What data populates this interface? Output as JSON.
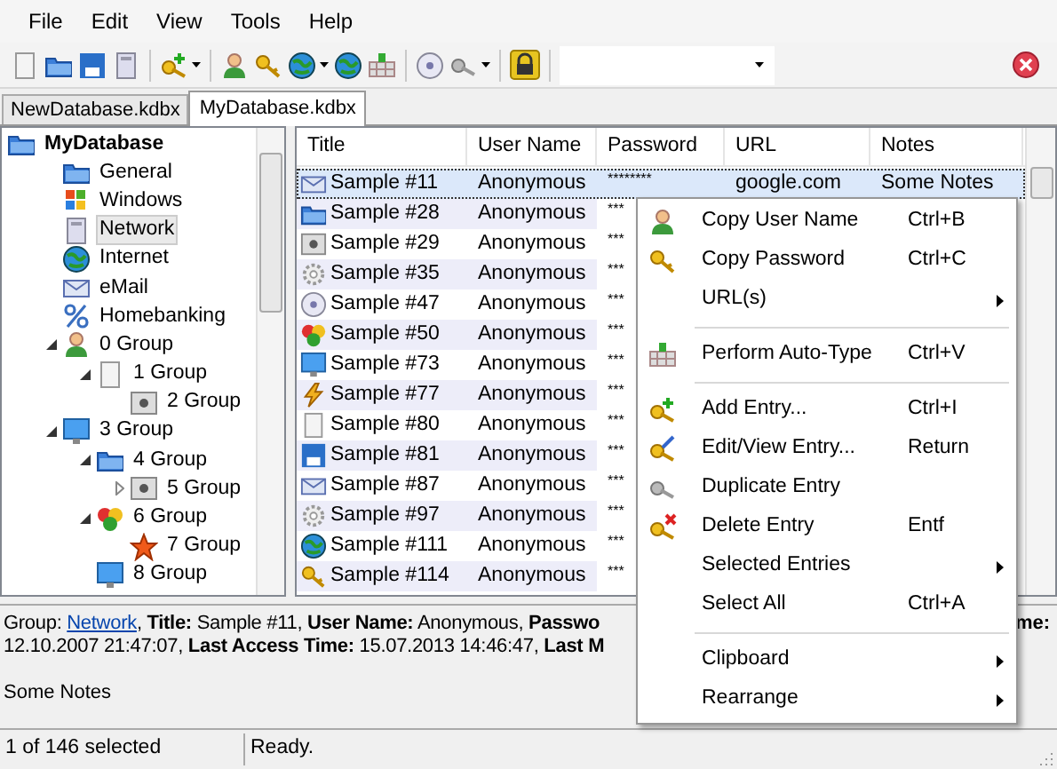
{
  "menu_bar": [
    "File",
    "Edit",
    "View",
    "Tools",
    "Help"
  ],
  "tabs": [
    {
      "label": "NewDatabase.kdbx",
      "selected": false
    },
    {
      "label": "MyDatabase.kdbx",
      "selected": true
    }
  ],
  "tree": [
    {
      "label": "MyDatabase",
      "selected": false,
      "children": [
        {
          "label": "General",
          "selected": false
        },
        {
          "label": "Windows",
          "selected": false
        },
        {
          "label": "Network",
          "selected": true
        },
        {
          "label": "Internet",
          "selected": false
        },
        {
          "label": "eMail",
          "selected": false
        },
        {
          "label": "Homebanking",
          "selected": false
        },
        {
          "label": "0 Group",
          "selected": false,
          "expanded": true,
          "children": [
            {
              "label": "1 Group",
              "selected": false,
              "expanded": true,
              "children": [
                {
                  "label": "2 Group",
                  "selected": false
                }
              ]
            }
          ]
        },
        {
          "label": "3 Group",
          "selected": false,
          "expanded": true,
          "children": [
            {
              "label": "4 Group",
              "selected": false,
              "expanded": true,
              "children": [
                {
                  "label": "5 Group",
                  "selected": false,
                  "expanded": false
                }
              ]
            },
            {
              "label": "6 Group",
              "selected": false,
              "expanded": true,
              "children": [
                {
                  "label": "7 Group",
                  "selected": false
                }
              ]
            },
            {
              "label": "8 Group",
              "selected": false
            }
          ]
        }
      ]
    }
  ],
  "table": {
    "columns": [
      "Title",
      "User Name",
      "Password",
      "URL",
      "Notes"
    ],
    "rows": [
      {
        "title": "Sample #11",
        "user_name": "Anonymous",
        "password": "********",
        "url": "google.com",
        "notes": "Some Notes",
        "selected": true
      },
      {
        "title": "Sample #28",
        "user_name": "Anonymous",
        "password": "***",
        "selected": false
      },
      {
        "title": "Sample #29",
        "user_name": "Anonymous",
        "password": "***",
        "selected": false
      },
      {
        "title": "Sample #35",
        "user_name": "Anonymous",
        "password": "***",
        "selected": false
      },
      {
        "title": "Sample #47",
        "user_name": "Anonymous",
        "password": "***",
        "selected": false
      },
      {
        "title": "Sample #50",
        "user_name": "Anonymous",
        "password": "***",
        "selected": false
      },
      {
        "title": "Sample #73",
        "user_name": "Anonymous",
        "password": "***",
        "selected": false
      },
      {
        "title": "Sample #77",
        "user_name": "Anonymous",
        "password": "***",
        "selected": false
      },
      {
        "title": "Sample #80",
        "user_name": "Anonymous",
        "password": "***",
        "selected": false
      },
      {
        "title": "Sample #81",
        "user_name": "Anonymous",
        "password": "***",
        "selected": false
      },
      {
        "title": "Sample #87",
        "user_name": "Anonymous",
        "password": "***",
        "selected": false
      },
      {
        "title": "Sample #97",
        "user_name": "Anonymous",
        "password": "***",
        "selected": false
      },
      {
        "title": "Sample #111",
        "user_name": "Anonymous",
        "password": "***",
        "selected": false
      },
      {
        "title": "Sample #114",
        "user_name": "Anonymous",
        "password": "***",
        "selected": false
      }
    ]
  },
  "details": {
    "group_label": "Group:",
    "group_link": "Network",
    "line_1_rest": ", **Title:** Sample #11, **User Name:** Anonymous, **Passwo**",
    "line_1_end": "**me:**",
    "line_2": "12.10.2007 21:47:07, **Last Access Time:** 15.07.2013 14:46:47, **Last M**",
    "notes": "Some Notes"
  },
  "context_menu": {
    "groups": [
      [
        {
          "label": "Copy User Name",
          "shortcut": "Ctrl+B",
          "submenu": false
        },
        {
          "label": "Copy Password",
          "shortcut": "Ctrl+C",
          "submenu": false
        },
        {
          "label": "URL(s)",
          "submenu": true
        }
      ],
      [
        {
          "label": "Perform Auto-Type",
          "shortcut": "Ctrl+V",
          "submenu": false
        }
      ],
      [
        {
          "label": "Add Entry...",
          "shortcut": "Ctrl+I",
          "submenu": false
        },
        {
          "label": "Edit/View Entry...",
          "shortcut": "Return",
          "submenu": false
        },
        {
          "label": "Duplicate Entry",
          "submenu": false
        },
        {
          "label": "Delete Entry",
          "shortcut": "Entf",
          "submenu": false
        },
        {
          "label": "Selected Entries",
          "submenu": true
        },
        {
          "label": "Select All",
          "shortcut": "Ctrl+A",
          "submenu": false
        }
      ],
      [
        {
          "label": "Clipboard",
          "submenu": true
        },
        {
          "label": "Rearrange",
          "submenu": true
        }
      ]
    ]
  },
  "status_bar": [
    "1 of 146 selected",
    "Ready."
  ]
}
